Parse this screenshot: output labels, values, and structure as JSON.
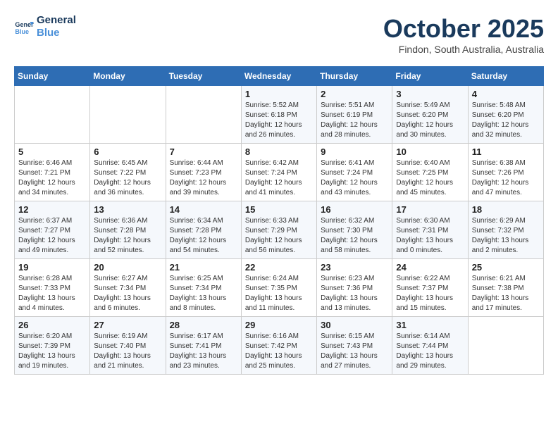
{
  "header": {
    "logo_line1": "General",
    "logo_line2": "Blue",
    "month": "October 2025",
    "location": "Findon, South Australia, Australia"
  },
  "days_of_week": [
    "Sunday",
    "Monday",
    "Tuesday",
    "Wednesday",
    "Thursday",
    "Friday",
    "Saturday"
  ],
  "weeks": [
    [
      {
        "day": "",
        "info": ""
      },
      {
        "day": "",
        "info": ""
      },
      {
        "day": "",
        "info": ""
      },
      {
        "day": "1",
        "info": "Sunrise: 5:52 AM\nSunset: 6:18 PM\nDaylight: 12 hours\nand 26 minutes."
      },
      {
        "day": "2",
        "info": "Sunrise: 5:51 AM\nSunset: 6:19 PM\nDaylight: 12 hours\nand 28 minutes."
      },
      {
        "day": "3",
        "info": "Sunrise: 5:49 AM\nSunset: 6:20 PM\nDaylight: 12 hours\nand 30 minutes."
      },
      {
        "day": "4",
        "info": "Sunrise: 5:48 AM\nSunset: 6:20 PM\nDaylight: 12 hours\nand 32 minutes."
      }
    ],
    [
      {
        "day": "5",
        "info": "Sunrise: 6:46 AM\nSunset: 7:21 PM\nDaylight: 12 hours\nand 34 minutes."
      },
      {
        "day": "6",
        "info": "Sunrise: 6:45 AM\nSunset: 7:22 PM\nDaylight: 12 hours\nand 36 minutes."
      },
      {
        "day": "7",
        "info": "Sunrise: 6:44 AM\nSunset: 7:23 PM\nDaylight: 12 hours\nand 39 minutes."
      },
      {
        "day": "8",
        "info": "Sunrise: 6:42 AM\nSunset: 7:24 PM\nDaylight: 12 hours\nand 41 minutes."
      },
      {
        "day": "9",
        "info": "Sunrise: 6:41 AM\nSunset: 7:24 PM\nDaylight: 12 hours\nand 43 minutes."
      },
      {
        "day": "10",
        "info": "Sunrise: 6:40 AM\nSunset: 7:25 PM\nDaylight: 12 hours\nand 45 minutes."
      },
      {
        "day": "11",
        "info": "Sunrise: 6:38 AM\nSunset: 7:26 PM\nDaylight: 12 hours\nand 47 minutes."
      }
    ],
    [
      {
        "day": "12",
        "info": "Sunrise: 6:37 AM\nSunset: 7:27 PM\nDaylight: 12 hours\nand 49 minutes."
      },
      {
        "day": "13",
        "info": "Sunrise: 6:36 AM\nSunset: 7:28 PM\nDaylight: 12 hours\nand 52 minutes."
      },
      {
        "day": "14",
        "info": "Sunrise: 6:34 AM\nSunset: 7:28 PM\nDaylight: 12 hours\nand 54 minutes."
      },
      {
        "day": "15",
        "info": "Sunrise: 6:33 AM\nSunset: 7:29 PM\nDaylight: 12 hours\nand 56 minutes."
      },
      {
        "day": "16",
        "info": "Sunrise: 6:32 AM\nSunset: 7:30 PM\nDaylight: 12 hours\nand 58 minutes."
      },
      {
        "day": "17",
        "info": "Sunrise: 6:30 AM\nSunset: 7:31 PM\nDaylight: 13 hours\nand 0 minutes."
      },
      {
        "day": "18",
        "info": "Sunrise: 6:29 AM\nSunset: 7:32 PM\nDaylight: 13 hours\nand 2 minutes."
      }
    ],
    [
      {
        "day": "19",
        "info": "Sunrise: 6:28 AM\nSunset: 7:33 PM\nDaylight: 13 hours\nand 4 minutes."
      },
      {
        "day": "20",
        "info": "Sunrise: 6:27 AM\nSunset: 7:34 PM\nDaylight: 13 hours\nand 6 minutes."
      },
      {
        "day": "21",
        "info": "Sunrise: 6:25 AM\nSunset: 7:34 PM\nDaylight: 13 hours\nand 8 minutes."
      },
      {
        "day": "22",
        "info": "Sunrise: 6:24 AM\nSunset: 7:35 PM\nDaylight: 13 hours\nand 11 minutes."
      },
      {
        "day": "23",
        "info": "Sunrise: 6:23 AM\nSunset: 7:36 PM\nDaylight: 13 hours\nand 13 minutes."
      },
      {
        "day": "24",
        "info": "Sunrise: 6:22 AM\nSunset: 7:37 PM\nDaylight: 13 hours\nand 15 minutes."
      },
      {
        "day": "25",
        "info": "Sunrise: 6:21 AM\nSunset: 7:38 PM\nDaylight: 13 hours\nand 17 minutes."
      }
    ],
    [
      {
        "day": "26",
        "info": "Sunrise: 6:20 AM\nSunset: 7:39 PM\nDaylight: 13 hours\nand 19 minutes."
      },
      {
        "day": "27",
        "info": "Sunrise: 6:19 AM\nSunset: 7:40 PM\nDaylight: 13 hours\nand 21 minutes."
      },
      {
        "day": "28",
        "info": "Sunrise: 6:17 AM\nSunset: 7:41 PM\nDaylight: 13 hours\nand 23 minutes."
      },
      {
        "day": "29",
        "info": "Sunrise: 6:16 AM\nSunset: 7:42 PM\nDaylight: 13 hours\nand 25 minutes."
      },
      {
        "day": "30",
        "info": "Sunrise: 6:15 AM\nSunset: 7:43 PM\nDaylight: 13 hours\nand 27 minutes."
      },
      {
        "day": "31",
        "info": "Sunrise: 6:14 AM\nSunset: 7:44 PM\nDaylight: 13 hours\nand 29 minutes."
      },
      {
        "day": "",
        "info": ""
      }
    ]
  ]
}
